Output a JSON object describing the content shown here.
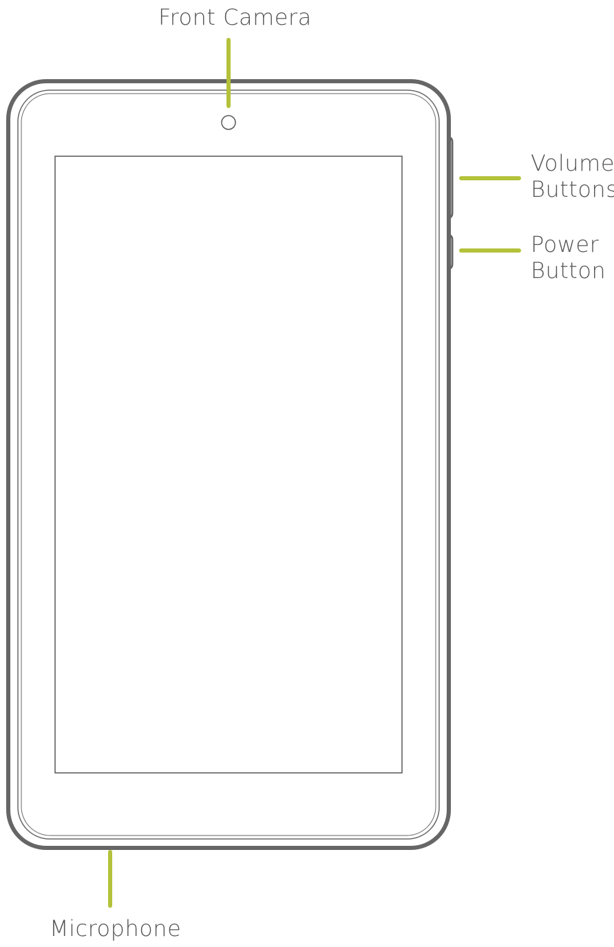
{
  "labels": {
    "front_camera": "Front Camera",
    "volume_line1": "Volume",
    "volume_line2": "Buttons",
    "power_line1": "Power",
    "power_line2": "Button",
    "microphone": "Microphone"
  },
  "colors": {
    "device_outline": "#666666",
    "callout_line": "#b3c23a",
    "label_text": "#555555"
  }
}
